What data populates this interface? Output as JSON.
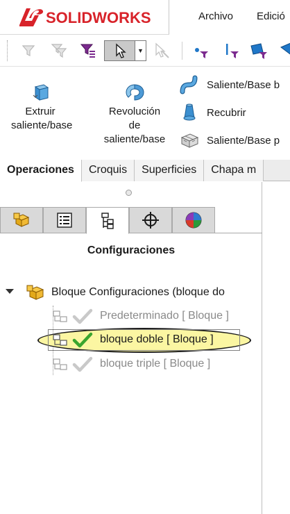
{
  "app": {
    "logo_ds": "DS",
    "logo_text": "SOLIDWORKS",
    "brand_color": "#d8232a",
    "menu": [
      "Archivo",
      "Edició"
    ]
  },
  "toolbar": {
    "items": [
      "filter-icon",
      "filter-toolbar-icon",
      "filter-selection-icon",
      "select-pointer-icon",
      "select-dropdown-icon",
      "smart-select-icon",
      "point-icon",
      "vertex-filter-icon",
      "face-filter-icon",
      "cone-icon"
    ]
  },
  "ribbon": {
    "extrude": {
      "line1": "Extruir",
      "line2": "saliente/base"
    },
    "revolve": {
      "line1": "Revolución",
      "line2": "de",
      "line3": "saliente/base"
    },
    "sweep": "Saliente/Base b",
    "loft": "Recubrir",
    "boundary": "Saliente/Base p"
  },
  "tabs": [
    "Operaciones",
    "Croquis",
    "Superficies",
    "Chapa m"
  ],
  "active_tab": "Operaciones",
  "panel": {
    "tabs": [
      "feature-manager-icon",
      "property-manager-icon",
      "configuration-manager-icon",
      "dimxpert-icon",
      "display-manager-icon"
    ],
    "active_tab_index": 2,
    "title": "Configuraciones",
    "root": {
      "label": "Bloque Configuraciones  (bloque do"
    },
    "configurations": [
      {
        "label": "Predeterminado [ Bloque ]",
        "active": false
      },
      {
        "label": "bloque doble [ Bloque ]",
        "active": true
      },
      {
        "label": "bloque triple [ Bloque ]",
        "active": false
      }
    ],
    "highlight_color": "#fbf6a2",
    "check_active_color": "#3aa52e",
    "check_inactive_color": "#c9c9c9"
  }
}
